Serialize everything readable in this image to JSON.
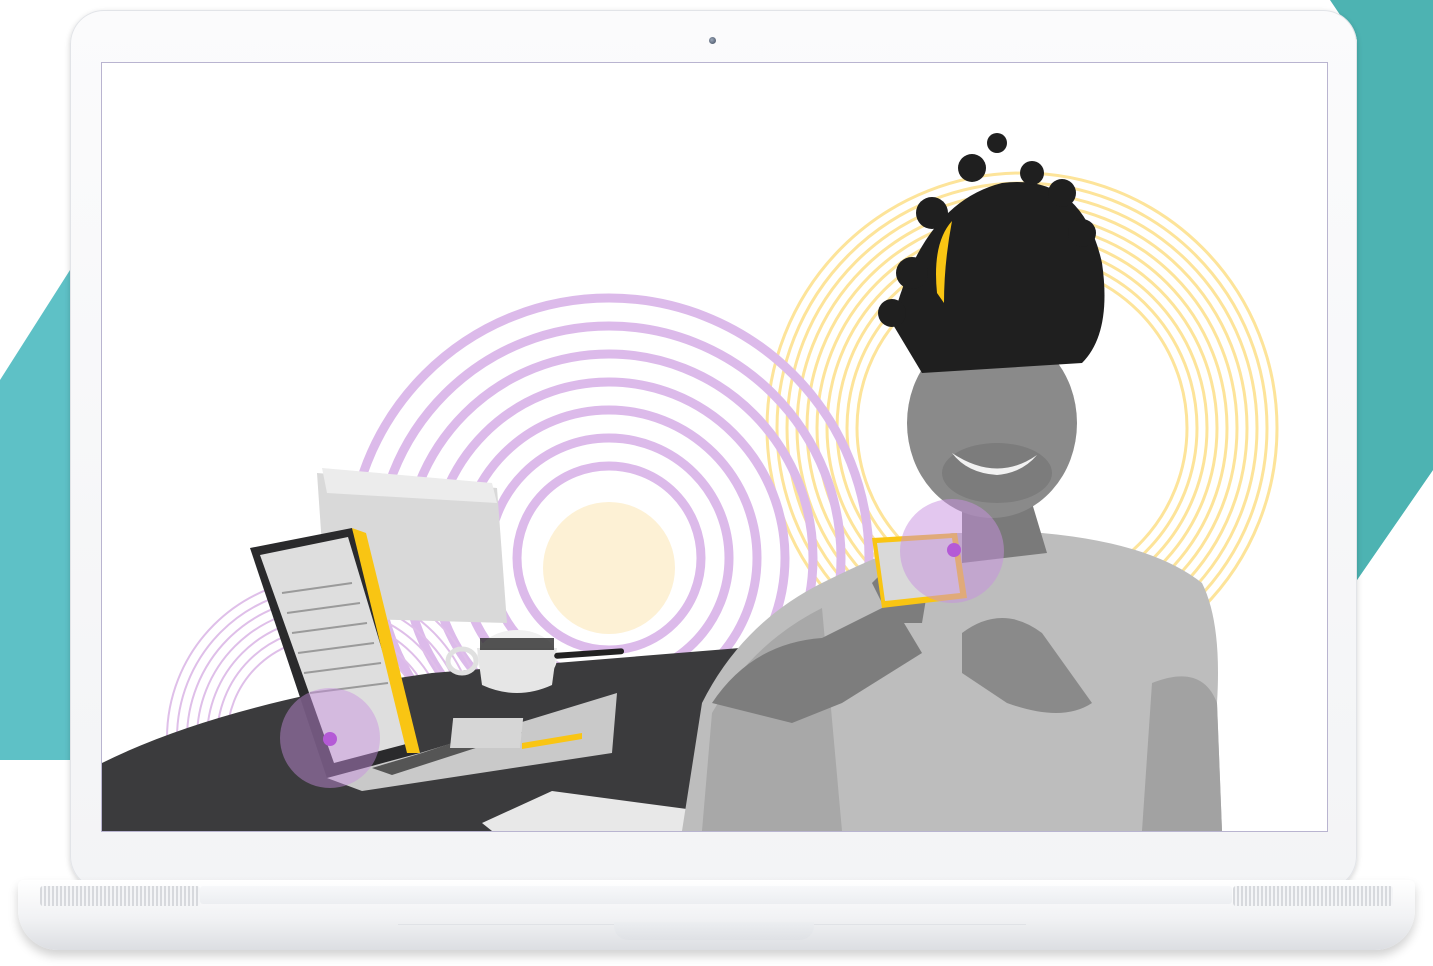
{
  "scene": {
    "background_accent": "#5bbcc4",
    "ring_purple": "#d8b4e6",
    "ring_yellow": "#fde49a",
    "highlight_yellow": "#f9c513",
    "dot_purple": "#b45ad6",
    "icons": [
      "camera-icon",
      "person-illustration",
      "laptop-illustration",
      "coffee-cup-illustration",
      "smartphone-illustration"
    ]
  }
}
